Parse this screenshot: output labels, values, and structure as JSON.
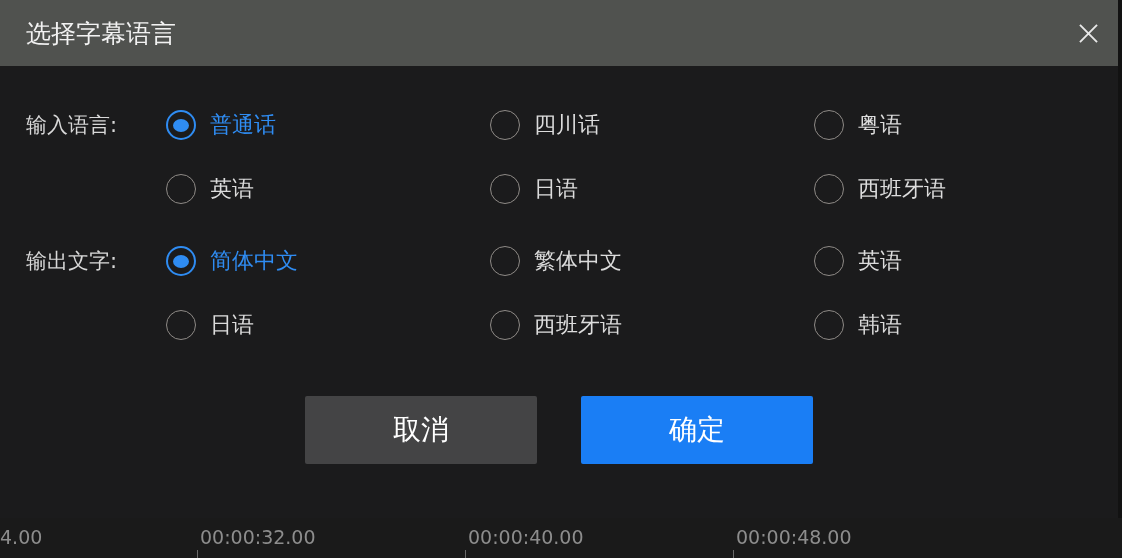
{
  "dialog": {
    "title": "选择字幕语言",
    "groups": [
      {
        "label": "输入语言:",
        "options": [
          {
            "label": "普通话",
            "selected": true
          },
          {
            "label": "四川话",
            "selected": false
          },
          {
            "label": "粤语",
            "selected": false
          },
          {
            "label": "英语",
            "selected": false
          },
          {
            "label": "日语",
            "selected": false
          },
          {
            "label": "西班牙语",
            "selected": false
          }
        ]
      },
      {
        "label": "输出文字:",
        "options": [
          {
            "label": "简体中文",
            "selected": true
          },
          {
            "label": "繁体中文",
            "selected": false
          },
          {
            "label": "英语",
            "selected": false
          },
          {
            "label": "日语",
            "selected": false
          },
          {
            "label": "西班牙语",
            "selected": false
          },
          {
            "label": "韩语",
            "selected": false
          }
        ]
      }
    ],
    "buttons": [
      {
        "label": "取消",
        "kind": "secondary"
      },
      {
        "label": "确定",
        "kind": "primary"
      }
    ]
  },
  "timeline": {
    "labels": [
      "4.00",
      "00:00:32.00",
      "00:00:40.00",
      "00:00:48.00"
    ]
  }
}
